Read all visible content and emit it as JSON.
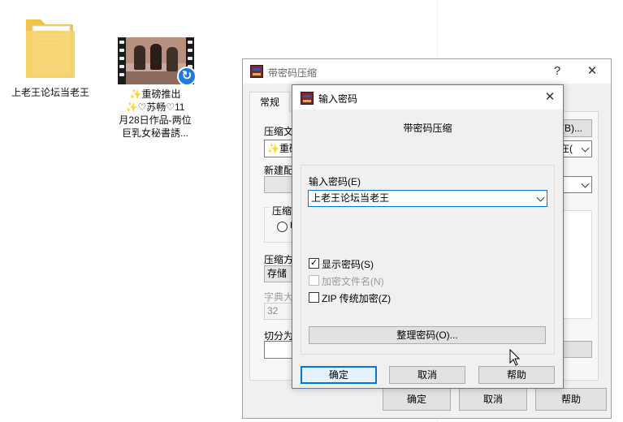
{
  "desktop": {
    "folder_label": "上老王论坛当老王",
    "video_label_lines": [
      "✨重磅推出",
      "✨♡苏畅♡11",
      "月28日作品-两位",
      "巨乳女秘書誘..."
    ]
  },
  "back_window": {
    "title": "带密码压缩",
    "help_glyph": "?",
    "close_glyph": "✕",
    "tab_general": "常规",
    "archive_name_label": "压缩文",
    "archive_name_value": "✨重磅",
    "browse_button": "(B)...",
    "update_mode_value": "在(",
    "profile_label": "新建配",
    "format_label": "压缩文",
    "radio_label": "R",
    "method_label": "压缩方",
    "method_value": "存储",
    "dict_label": "字典大",
    "dict_value": "32",
    "split_label": "切分为",
    "ok_button": "确定",
    "cancel_button": "取消",
    "help_button": "帮助"
  },
  "password_dialog": {
    "title": "输入密码",
    "close_glyph": "✕",
    "heading": "带密码压缩",
    "password_label": "输入密码(E)",
    "password_value": "上老王论坛当老王",
    "show_password": {
      "label": "显示密码(S)",
      "checked": true,
      "mark": "✓"
    },
    "encrypt_filenames": {
      "label": "加密文件名(N)",
      "checked": false,
      "disabled": true
    },
    "zip_legacy": {
      "label": "ZIP 传统加密(Z)",
      "checked": false
    },
    "organize_button": "整理密码(O)...",
    "ok_button": "确定",
    "cancel_button": "取消",
    "help_button": "帮助"
  }
}
